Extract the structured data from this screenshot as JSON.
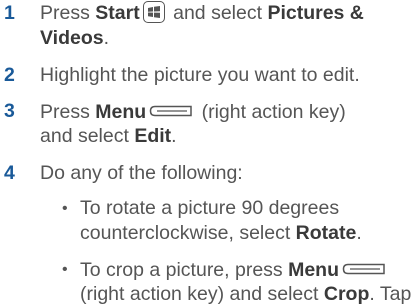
{
  "steps": [
    {
      "number": "1",
      "text1": "Press ",
      "bold1": "Start",
      "icon": "windows-start-icon",
      "text2": " and select ",
      "bold2": "Pictures &",
      "bold3": "Videos",
      "text3": "."
    },
    {
      "number": "2",
      "text": "Highlight the picture you want to edit."
    },
    {
      "number": "3",
      "text1": "Press ",
      "bold1": "Menu",
      "icon": "right-action-key-icon",
      "text2": " (right action key)",
      "text3": "and select ",
      "bold2": "Edit",
      "text4": "."
    },
    {
      "number": "4",
      "text": "Do any of the following:"
    }
  ],
  "bullets": [
    {
      "symbol": "•",
      "line1": "To rotate a picture 90 degrees",
      "text2": "counterclockwise, select ",
      "bold": "Rotate",
      "text3": "."
    },
    {
      "symbol": "•",
      "text1": "To crop a picture, press ",
      "bold1": "Menu",
      "icon": "right-action-key-icon",
      "text2": "(right action key) and select ",
      "bold2": "Crop",
      "text3": ". Tap"
    }
  ]
}
